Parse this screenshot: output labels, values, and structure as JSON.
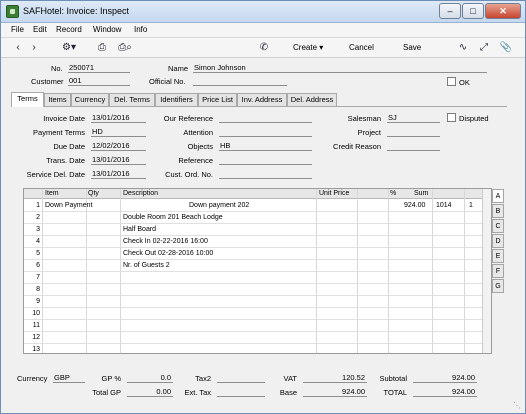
{
  "window": {
    "title": "SAFHotel: Invoice: Inspect"
  },
  "menu": [
    "File",
    "Edit",
    "Record",
    "Window",
    "Info"
  ],
  "toolbar": {
    "create": "Create",
    "cancel": "Cancel",
    "save": "Save"
  },
  "header": {
    "no_label": "No.",
    "no_value": "250071",
    "name_label": "Name",
    "name_value": "Simon Johnson",
    "customer_label": "Customer",
    "customer_value": "001",
    "official_label": "Official No.",
    "official_value": "",
    "ok_label": "OK"
  },
  "tabs": [
    "Terms",
    "Items",
    "Currency",
    "Del. Terms",
    "Identifiers",
    "Price List",
    "Inv. Address",
    "Del. Address"
  ],
  "terms": {
    "invoice_date_label": "Invoice Date",
    "invoice_date": "13/01/2016",
    "payment_terms_label": "Payment Terms",
    "payment_terms": "HD",
    "due_date_label": "Due Date",
    "due_date": "12/02/2016",
    "trans_date_label": "Trans. Date",
    "trans_date": "13/01/2016",
    "service_del_date_label": "Service Del. Date",
    "service_del_date": "13/01/2016",
    "our_reference_label": "Our Reference",
    "our_reference": "",
    "attention_label": "Attention",
    "attention": "",
    "objects_label": "Objects",
    "objects": "HB",
    "reference_label": "Reference",
    "reference": "",
    "cust_ord_label": "Cust. Ord. No.",
    "cust_ord": "",
    "salesman_label": "Salesman",
    "salesman": "SJ",
    "project_label": "Project",
    "project": "",
    "credit_reason_label": "Credit Reason",
    "credit_reason": "",
    "disputed_label": "Disputed"
  },
  "grid": {
    "columns": [
      "Item",
      "Qty",
      "Description",
      "Unit Price",
      "%",
      "Sum"
    ],
    "rows": [
      {
        "n": "1",
        "item": "Down Payment",
        "desc": "",
        "desc2": "Down payment 202",
        "sum": "924.00",
        "c1": "1014",
        "c2": "1"
      },
      {
        "n": "2",
        "item": "",
        "desc": "Double Room 201 Beach Lodge"
      },
      {
        "n": "3",
        "item": "",
        "desc": "Half Board"
      },
      {
        "n": "4",
        "item": "",
        "desc": "Check In 02-22-2016  16:00"
      },
      {
        "n": "5",
        "item": "",
        "desc": "Check Out 02-28-2016  10:00"
      },
      {
        "n": "6",
        "item": "",
        "desc": "Nr. of Guests 2"
      },
      {
        "n": "7",
        "item": "",
        "desc": ""
      },
      {
        "n": "8",
        "item": "",
        "desc": ""
      },
      {
        "n": "9",
        "item": "",
        "desc": ""
      },
      {
        "n": "10",
        "item": "",
        "desc": ""
      },
      {
        "n": "11",
        "item": "",
        "desc": ""
      },
      {
        "n": "12",
        "item": "",
        "desc": ""
      },
      {
        "n": "13",
        "item": "",
        "desc": ""
      }
    ],
    "side_tabs": [
      "A",
      "B",
      "C",
      "D",
      "E",
      "F",
      "G"
    ]
  },
  "footer": {
    "currency_label": "Currency",
    "currency": "GBP",
    "gp_pct_label": "GP %",
    "gp_pct": "0.0",
    "total_gp_label": "Total GP",
    "total_gp": "0.00",
    "tax2_label": "Tax2",
    "tax2": "",
    "ext_tax_label": "Ext. Tax",
    "ext_tax": "",
    "vat_label": "VAT",
    "vat": "120.52",
    "base_label": "Base",
    "base": "924.00",
    "subtotal_label": "Subtotal",
    "subtotal": "924.00",
    "total_label": "TOTAL",
    "total": "924.00"
  }
}
